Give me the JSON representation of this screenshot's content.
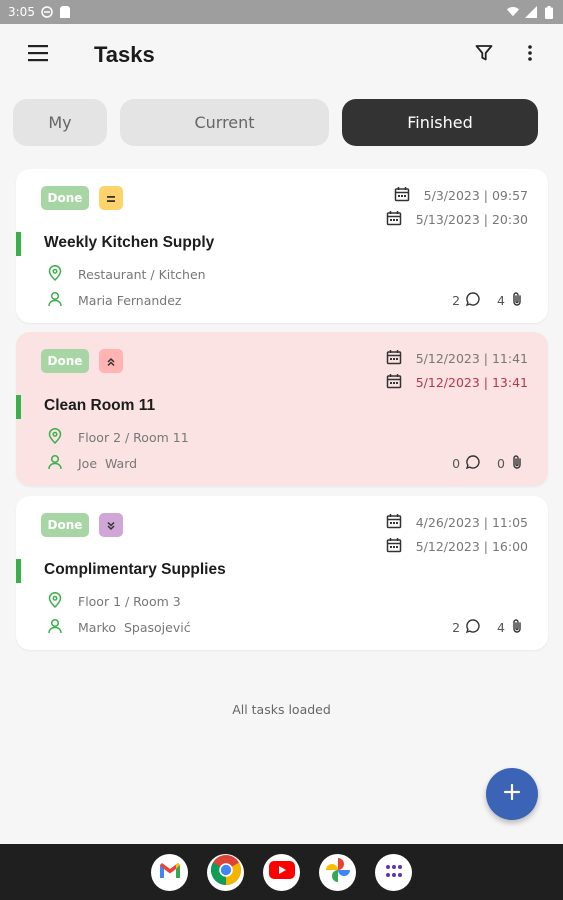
{
  "status_bar": {
    "time": "3:05"
  },
  "app_bar": {
    "title": "Tasks"
  },
  "tabs": [
    {
      "label": "My"
    },
    {
      "label": "Current"
    },
    {
      "label": "Finished",
      "selected": true
    }
  ],
  "tasks": [
    {
      "status": "Done",
      "priority": "=",
      "priority_level": "medium",
      "start": "5/3/2023 | 09:57",
      "due": "5/13/2023 | 20:30",
      "due_overdue": false,
      "title": "Weekly Kitchen Supply",
      "location": "Restaurant / Kitchen",
      "assignee": "Maria Fernandez",
      "comments": "2",
      "attachments": "4",
      "overdue": false
    },
    {
      "status": "Done",
      "priority": "⌃⌃",
      "priority_level": "high",
      "start": "5/12/2023 | 11:41",
      "due": "5/12/2023 | 13:41",
      "due_overdue": true,
      "title": "Clean Room 11",
      "location": "Floor 2 / Room 11",
      "assignee": "Joe  Ward",
      "comments": "0",
      "attachments": "0",
      "overdue": true
    },
    {
      "status": "Done",
      "priority": "⌄⌄",
      "priority_level": "low",
      "start": "4/26/2023 | 11:05",
      "due": "5/12/2023 | 16:00",
      "due_overdue": false,
      "title": "Complimentary Supplies",
      "location": "Floor 1 / Room 3",
      "assignee": "Marko  Spasojević",
      "comments": "2",
      "attachments": "4",
      "overdue": false
    }
  ],
  "footer_text": "All tasks loaded",
  "fab_icon": "plus-icon",
  "dock": [
    "gmail-icon",
    "chrome-icon",
    "youtube-icon",
    "photos-icon",
    "app-drawer-icon"
  ],
  "colors": {
    "accent": "#3b63b6",
    "done_badge": "#a7d6a4",
    "overdue_bg": "#fce3e3",
    "overdue_text": "#b23a48",
    "selected_tab": "#333333",
    "status_accent": "#3ab04a"
  }
}
